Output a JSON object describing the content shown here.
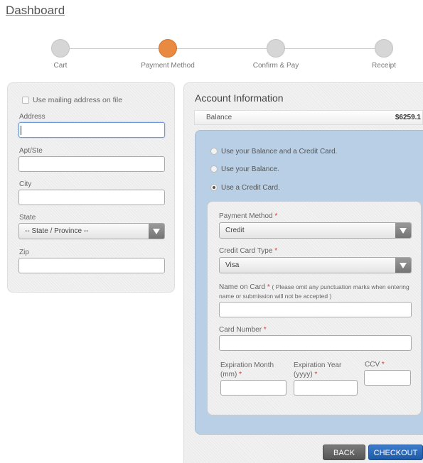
{
  "page": {
    "title": "Dashboard"
  },
  "steps": [
    {
      "label": "Cart",
      "active": false
    },
    {
      "label": "Payment Method",
      "active": true
    },
    {
      "label": "Confirm & Pay",
      "active": false
    },
    {
      "label": "Receipt",
      "active": false
    }
  ],
  "address_form": {
    "use_mailing_label": "Use mailing address on file",
    "address_label": "Address",
    "address_value": "",
    "apt_label": "Apt/Ste",
    "apt_value": "",
    "city_label": "City",
    "city_value": "",
    "state_label": "State",
    "state_value": "-- State / Province --",
    "zip_label": "Zip",
    "zip_value": ""
  },
  "account": {
    "title": "Account Information",
    "balance_label": "Balance",
    "balance_value": "$6259.1",
    "options": [
      {
        "label": "Use your Balance and a Credit Card.",
        "selected": false
      },
      {
        "label": "Use your Balance.",
        "selected": false
      },
      {
        "label": "Use a Credit Card.",
        "selected": true
      }
    ]
  },
  "card_form": {
    "payment_method_label": "Payment Method",
    "payment_method_value": "Credit",
    "card_type_label": "Credit Card Type",
    "card_type_value": "Visa",
    "name_label": "Name on Card",
    "name_note_line1": "( Please omit any punctuation marks when entering",
    "name_note_line2": "name or submission will not be accepted )",
    "card_number_label": "Card Number",
    "exp_month_label_1": "Expiration Month",
    "exp_month_label_2": "(mm)",
    "exp_year_label_1": "Expiration Year",
    "exp_year_label_2": "(yyyy)",
    "ccv_label": "CCV",
    "required_mark": "*"
  },
  "buttons": {
    "back": "BACK",
    "checkout": "CHECKOUT"
  },
  "colors": {
    "active_step": "#e98a42",
    "blue_panel": "#b9cfe5",
    "checkout": "#2966b8"
  }
}
